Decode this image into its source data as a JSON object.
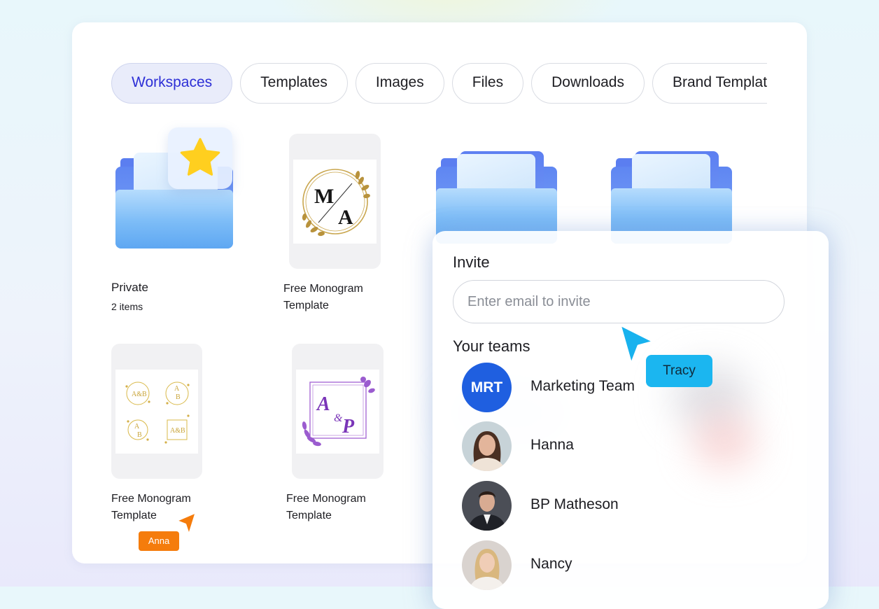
{
  "tabs": [
    {
      "label": "Workspaces",
      "active": true
    },
    {
      "label": "Templates",
      "active": false
    },
    {
      "label": "Images",
      "active": false
    },
    {
      "label": "Files",
      "active": false
    },
    {
      "label": "Downloads",
      "active": false
    },
    {
      "label": "Brand Templates",
      "active": false
    }
  ],
  "items": {
    "private": {
      "name": "Private",
      "count": "2 items",
      "icon": "star-icon"
    },
    "monogram_ma": {
      "line1": "Free Monogram",
      "line2": "Template",
      "letters": [
        "M",
        "A"
      ]
    },
    "monogram_ab": {
      "line1": "Free Monogram",
      "line2": "Template"
    },
    "monogram_ap": {
      "line1": "Free Monogram",
      "line2": "Template",
      "letters": [
        "A",
        "&",
        "P"
      ]
    }
  },
  "cursors": {
    "anna": {
      "name": "Anna",
      "color": "#f57c0c"
    },
    "tracy": {
      "name": "Tracy",
      "color": "#1bb6f0"
    }
  },
  "invite": {
    "title": "Invite",
    "placeholder": "Enter email to invite",
    "teams_title": "Your teams",
    "teams": [
      {
        "name": "Marketing Team",
        "avatar_text": "MRT"
      },
      {
        "name": "Hanna",
        "avatar": "user-photo"
      },
      {
        "name": "BP Matheson",
        "avatar": "user-photo"
      },
      {
        "name": "Nancy",
        "avatar": "user-photo"
      }
    ]
  },
  "colors": {
    "accent": "#2d2fd6",
    "team_avatar": "#1f5fe0",
    "folder_blue": "#6fb2f6"
  }
}
